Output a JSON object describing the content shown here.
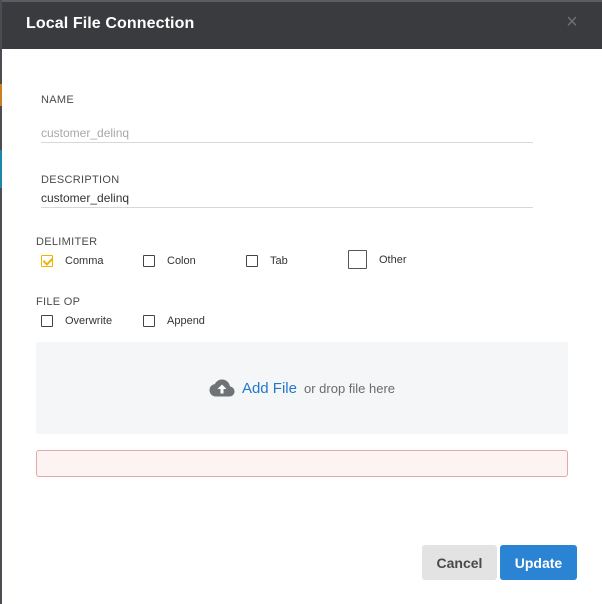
{
  "dialog": {
    "title": "Local File Connection",
    "close_symbol": "×",
    "close_icon": "close-icon"
  },
  "form": {
    "name": {
      "label": "NAME",
      "placeholder": "customer_delinq",
      "value": ""
    },
    "description": {
      "label": "DESCRIPTION",
      "value": "customer_delinq"
    },
    "delimiter": {
      "label": "DELIMITER",
      "options": [
        {
          "label": "Comma",
          "checked": true
        },
        {
          "label": "Colon",
          "checked": false
        },
        {
          "label": "Tab",
          "checked": false
        },
        {
          "label": "Other",
          "checked": false
        }
      ]
    },
    "file_op": {
      "label": "FILE OP",
      "options": [
        {
          "label": "Overwrite",
          "checked": false
        },
        {
          "label": "Append",
          "checked": false
        }
      ]
    }
  },
  "dropzone": {
    "icon": "cloud-upload-icon",
    "add_label": "Add File",
    "or_label": "or drop file here"
  },
  "footer": {
    "cancel_label": "Cancel",
    "update_label": "Update"
  },
  "colors": {
    "header_bg": "#3a3b3e",
    "accent_check": "#f0b400",
    "primary": "#2b83d4",
    "link": "#2378c8",
    "error_border": "#e5a8a8"
  }
}
